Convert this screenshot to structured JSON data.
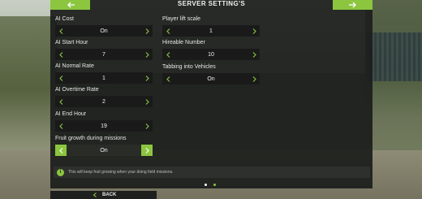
{
  "title": "SERVER SETTING'S",
  "accent_color": "#8cc63f",
  "left_column": [
    {
      "label": "AI Cost",
      "value": "On"
    },
    {
      "label": "AI Start Hour",
      "value": "7"
    },
    {
      "label": "AI Normal Rate",
      "value": "1"
    },
    {
      "label": "AI Overtime Rate",
      "value": "2"
    },
    {
      "label": "AI End Hour",
      "value": "19"
    },
    {
      "label": "Fruit growth during missions",
      "value": "On"
    }
  ],
  "right_column": [
    {
      "label": "Player lift scale",
      "value": "1"
    },
    {
      "label": "Hireable Number",
      "value": "10"
    },
    {
      "label": "Tabbing into Vehicles",
      "value": "On"
    }
  ],
  "info": {
    "icon": "info-icon",
    "glyph": "i",
    "text": "This will keep fruit growing when your doing field missions."
  },
  "pagination": {
    "current_page": 2,
    "total_pages": 2
  },
  "footer": {
    "back_label": "BACK"
  }
}
